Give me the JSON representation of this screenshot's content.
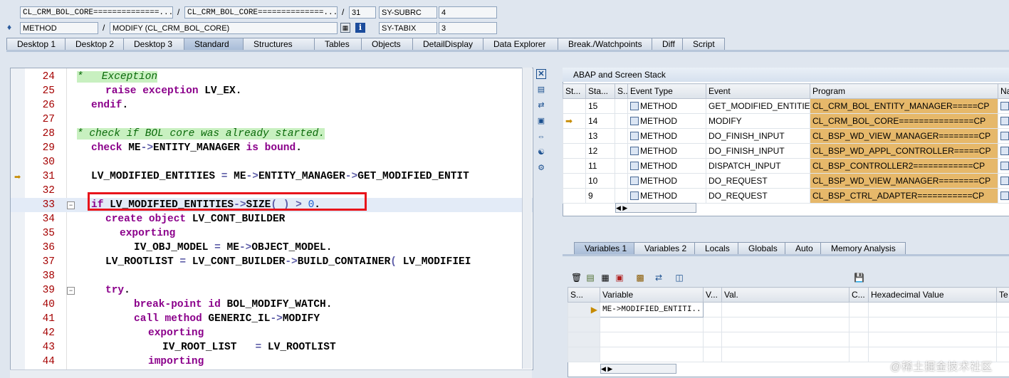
{
  "header": {
    "row1": {
      "class1": "CL_CRM_BOL_CORE==============...",
      "sep1": "/",
      "class2": "CL_CRM_BOL_CORE==============...",
      "sep2": "/",
      "line": "31",
      "sy_label": "SY-SUBRC",
      "sy_value": "4"
    },
    "row2": {
      "type": "METHOD",
      "sep": "/",
      "method": "MODIFY (CL_CRM_BOL_CORE)",
      "sy_label": "SY-TABIX",
      "sy_value": "3"
    }
  },
  "tabs": [
    "Desktop 1",
    "Desktop 2",
    "Desktop 3",
    "Standard",
    "Structures",
    "Tables",
    "Objects",
    "DetailDisplay",
    "Data Explorer",
    "Break./Watchpoints",
    "Diff",
    "Script"
  ],
  "active_tab": "Standard",
  "code": [
    {
      "n": "24"
    },
    {
      "n": "25"
    },
    {
      "n": "26"
    },
    {
      "n": "27"
    },
    {
      "n": "28"
    },
    {
      "n": "29"
    },
    {
      "n": "30"
    },
    {
      "n": "31"
    },
    {
      "n": "32"
    },
    {
      "n": "33"
    },
    {
      "n": "34"
    },
    {
      "n": "35"
    },
    {
      "n": "36"
    },
    {
      "n": "37"
    },
    {
      "n": "38"
    },
    {
      "n": "39"
    },
    {
      "n": "40"
    },
    {
      "n": "41"
    },
    {
      "n": "42"
    },
    {
      "n": "43"
    },
    {
      "n": "44"
    }
  ],
  "code_text": {
    "l24_cmt": "*   Exception",
    "l25_kw": "raise exception",
    "l25_rest": " LV_EX.",
    "l26_kw": "endif",
    "l26_rest": ".",
    "l28_cmt": "* check if BOL core was already started.",
    "l29_kw1": "check",
    "l29_a": " ME",
    "l29_op": "->",
    "l29_b": "ENTITY_MANAGER ",
    "l29_kw2": "is bound",
    "l29_c": ".",
    "l31_a": "LV_MODIFIED_ENTITIES ",
    "l31_op1": "=",
    "l31_b": " ME",
    "l31_op2": "->",
    "l31_c": "ENTITY_MANAGER",
    "l31_op3": "->",
    "l31_d": "GET_MODIFIED_ENTIT",
    "l33_kw": "if",
    "l33_a": " LV_MODIFIED_ENTITIES",
    "l33_op1": "->",
    "l33_b": "SIZE",
    "l33_op2": "( ) >",
    "l33_num": " 0",
    "l33_c": ".",
    "l34_kw": "create object",
    "l34_rest": " LV_CONT_BUILDER",
    "l35_kw": "exporting",
    "l36_a": "IV_OBJ_MODEL ",
    "l36_op1": "=",
    "l36_b": " ME",
    "l36_op2": "->",
    "l36_c": "OBJECT_MODEL.",
    "l37_a": "LV_ROOTLIST ",
    "l37_op1": "=",
    "l37_b": " LV_CONT_BUILDER",
    "l37_op2": "->",
    "l37_c": "BUILD_CONTAINER",
    "l37_op3": "(",
    "l37_d": " LV_MODIFIEI",
    "l39_kw": "try",
    "l39_rest": ".",
    "l40_kw1": "break-point",
    "l40_kw2": " id",
    "l40_rest": " BOL_MODIFY_WATCH.",
    "l41_kw": "call method",
    "l41_a": " GENERIC_IL",
    "l41_op": "->",
    "l41_b": "MODIFY",
    "l42_kw": "exporting",
    "l43_a": "IV_ROOT_LIST   ",
    "l43_op": "=",
    "l43_b": " LV_ROOTLIST",
    "l44_kw": "importing"
  },
  "stack": {
    "title": "ABAP and Screen Stack",
    "columns": [
      "St...",
      "Sta...",
      "S...",
      "Event Type",
      "Event",
      "Program",
      "Na"
    ],
    "rows": [
      {
        "level": "15",
        "type": "METHOD",
        "event": "GET_MODIFIED_ENTITIE...",
        "program": "CL_CRM_BOL_ENTITY_MANAGER=====CP",
        "current": false
      },
      {
        "level": "14",
        "type": "METHOD",
        "event": "MODIFY",
        "program": "CL_CRM_BOL_CORE===============CP",
        "current": true
      },
      {
        "level": "13",
        "type": "METHOD",
        "event": "DO_FINISH_INPUT",
        "program": "CL_BSP_WD_VIEW_MANAGER========CP",
        "current": false
      },
      {
        "level": "12",
        "type": "METHOD",
        "event": "DO_FINISH_INPUT",
        "program": "CL_BSP_WD_APPL_CONTROLLER=====CP",
        "current": false
      },
      {
        "level": "11",
        "type": "METHOD",
        "event": "DISPATCH_INPUT",
        "program": "CL_BSP_CONTROLLER2============CP",
        "current": false
      },
      {
        "level": "10",
        "type": "METHOD",
        "event": "DO_REQUEST",
        "program": "CL_BSP_WD_VIEW_MANAGER========CP",
        "current": false
      },
      {
        "level": "9",
        "type": "METHOD",
        "event": "DO_REQUEST",
        "program": "CL_BSP_CTRL_ADAPTER===========CP",
        "current": false
      }
    ]
  },
  "var_tabs": [
    "Variables 1",
    "Variables 2",
    "Locals",
    "Globals",
    "Auto",
    "Memory Analysis"
  ],
  "var_active": "Variables 1",
  "vars": {
    "columns": [
      "S...",
      "Variable",
      "V...",
      "Val.",
      "C...",
      "Hexadecimal Value",
      "Te"
    ],
    "rows": [
      {
        "variable": "ME->MODIFIED_ENTITI..."
      }
    ]
  },
  "watermark": "@稀土掘金技术社区",
  "colors": {
    "program_cell": "#e6b86a",
    "breakpoint_box": "#e8141b",
    "comment_bg": "#c8f0c0",
    "keyword": "#8b008b",
    "line_number": "#a50000"
  }
}
